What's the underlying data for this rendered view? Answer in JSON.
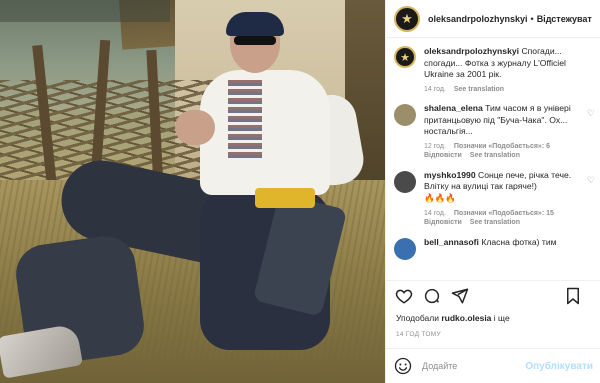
{
  "post": {
    "username": "oleksandrpolozhynskyi",
    "separator": "•",
    "follow_label": "Відстежувати",
    "avatar_glyph": "★",
    "caption_user": "oleksandrpolozhynskyi",
    "caption_text": "Спогади... спогади... Фотка з журналу L'Officiel Ukraine за 2001 рік.",
    "caption_time": "14 год.",
    "caption_translation": "See translation"
  },
  "comments": [
    {
      "user": "shalena_elena",
      "text": "Тим часом я в універі пританцьовую під \"Буча-Чака\". Ох... ностальгія...",
      "time": "12 год.",
      "likes": "Позначки «Подобається»: 6",
      "reply": "Відповісти",
      "translation": "See translation",
      "avatar_color": "#9a8f6a"
    },
    {
      "user": "myshko1990",
      "text": "Сонце пече, річка тече. Влітку на вулиці так гаряче!)",
      "emoji": "🔥🔥🔥",
      "time": "14 год.",
      "likes": "Позначки «Подобається»: 15",
      "reply": "Відповісти",
      "translation": "See translation",
      "avatar_color": "#4a4a4a"
    },
    {
      "user": "bell_annasofi",
      "text": "Класна фотка) тим",
      "avatar_color": "#3a6fb0"
    }
  ],
  "actions": {
    "heart": "heart-icon",
    "comment": "comment-icon",
    "share": "share-icon",
    "save": "bookmark-icon"
  },
  "likes": {
    "prefix": "Уподобали",
    "user": "rudko.olesia",
    "suffix": "і ще"
  },
  "posted_ago": "14 ГОД ТОМУ",
  "add_comment": {
    "placeholder": "Додайте",
    "post_label": "Опублікувати"
  }
}
